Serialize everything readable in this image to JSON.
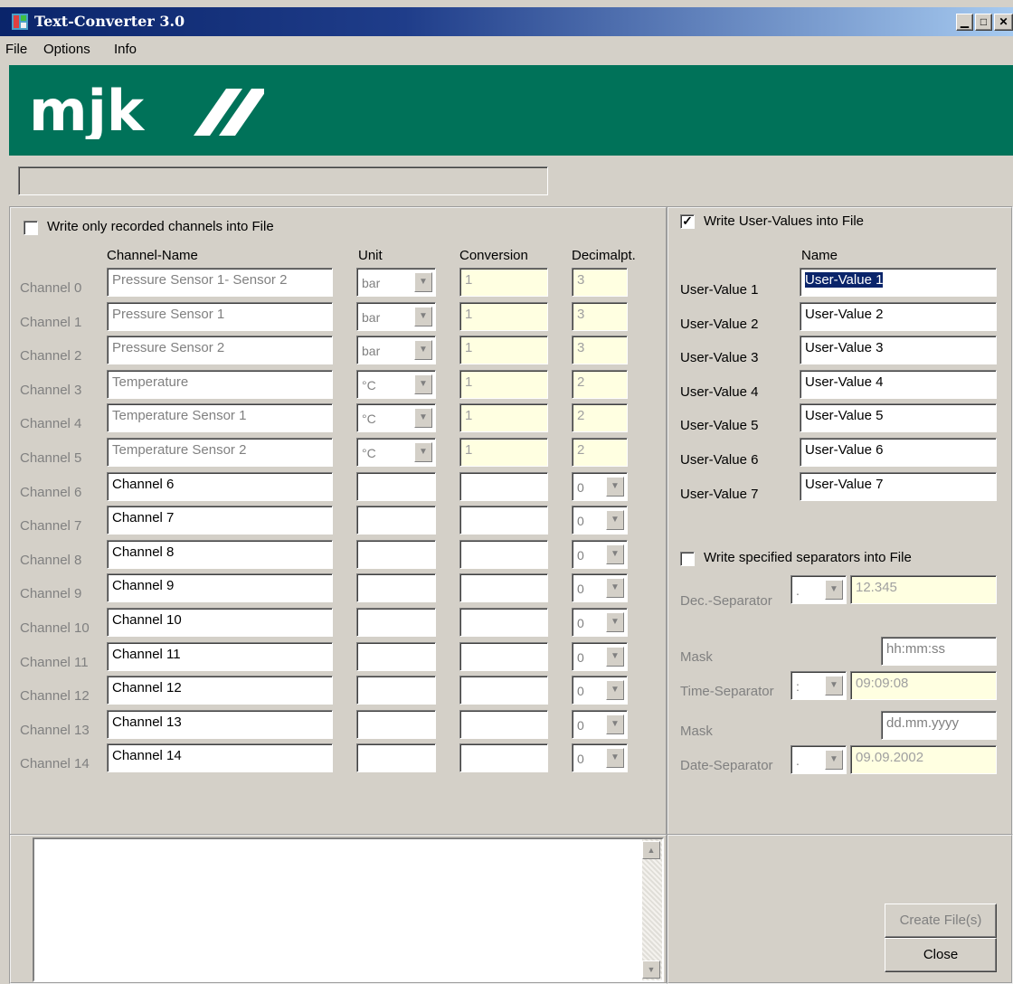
{
  "window": {
    "title": "Text-Converter 3.0"
  },
  "menu": {
    "file": "File",
    "options": "Options",
    "info": "Info"
  },
  "brand": {
    "logo_text": "mjk",
    "bg_color": "#007259"
  },
  "channels_panel": {
    "write_only_recorded_label": "Write only recorded channels into File",
    "write_only_recorded_checked": false,
    "headers": {
      "name": "Channel-Name",
      "unit": "Unit",
      "conversion": "Conversion",
      "decimalpt": "Decimalpt."
    },
    "rows": [
      {
        "label": "Channel 0",
        "name": "Pressure Sensor 1- Sensor 2",
        "unit": "bar",
        "conversion": "1",
        "decimal": "3",
        "recorded": true
      },
      {
        "label": "Channel 1",
        "name": "Pressure Sensor 1",
        "unit": "bar",
        "conversion": "1",
        "decimal": "3",
        "recorded": true
      },
      {
        "label": "Channel 2",
        "name": "Pressure Sensor 2",
        "unit": "bar",
        "conversion": "1",
        "decimal": "3",
        "recorded": true
      },
      {
        "label": "Channel 3",
        "name": "Temperature",
        "unit": "°C",
        "conversion": "1",
        "decimal": "2",
        "recorded": true
      },
      {
        "label": "Channel 4",
        "name": "Temperature Sensor 1",
        "unit": "°C",
        "conversion": "1",
        "decimal": "2",
        "recorded": true
      },
      {
        "label": "Channel 5",
        "name": "Temperature Sensor 2",
        "unit": "°C",
        "conversion": "1",
        "decimal": "2",
        "recorded": true
      },
      {
        "label": "Channel 6",
        "name": "Channel 6",
        "unit": "",
        "conversion": "",
        "decimal": "0",
        "recorded": false
      },
      {
        "label": "Channel 7",
        "name": "Channel 7",
        "unit": "",
        "conversion": "",
        "decimal": "0",
        "recorded": false
      },
      {
        "label": "Channel 8",
        "name": "Channel 8",
        "unit": "",
        "conversion": "",
        "decimal": "0",
        "recorded": false
      },
      {
        "label": "Channel 9",
        "name": "Channel 9",
        "unit": "",
        "conversion": "",
        "decimal": "0",
        "recorded": false
      },
      {
        "label": "Channel 10",
        "name": "Channel 10",
        "unit": "",
        "conversion": "",
        "decimal": "0",
        "recorded": false
      },
      {
        "label": "Channel 11",
        "name": "Channel 11",
        "unit": "",
        "conversion": "",
        "decimal": "0",
        "recorded": false
      },
      {
        "label": "Channel 12",
        "name": "Channel 12",
        "unit": "",
        "conversion": "",
        "decimal": "0",
        "recorded": false
      },
      {
        "label": "Channel 13",
        "name": "Channel 13",
        "unit": "",
        "conversion": "",
        "decimal": "0",
        "recorded": false
      },
      {
        "label": "Channel 14",
        "name": "Channel 14",
        "unit": "",
        "conversion": "",
        "decimal": "0",
        "recorded": false
      }
    ]
  },
  "user_values_panel": {
    "write_user_values_label": "Write User-Values into File",
    "write_user_values_checked": true,
    "name_header": "Name",
    "items": [
      {
        "label": "User-Value 1",
        "value": "User-Value 1"
      },
      {
        "label": "User-Value 2",
        "value": "User-Value 2"
      },
      {
        "label": "User-Value 3",
        "value": "User-Value 3"
      },
      {
        "label": "User-Value 4",
        "value": "User-Value 4"
      },
      {
        "label": "User-Value 5",
        "value": "User-Value 5"
      },
      {
        "label": "User-Value 6",
        "value": "User-Value 6"
      },
      {
        "label": "User-Value 7",
        "value": "User-Value 7"
      }
    ]
  },
  "separators_panel": {
    "write_separators_label": "Write specified separators into File",
    "write_separators_checked": false,
    "dec_label": "Dec.-Separator",
    "dec_value": ".",
    "dec_preview": "12.345",
    "time_mask_label": "Mask",
    "time_mask": "hh:mm:ss",
    "time_label": "Time-Separator",
    "time_value": ":",
    "time_preview": "09:09:08",
    "date_mask_label": "Mask",
    "date_mask": "dd.mm.yyyy",
    "date_label": "Date-Separator",
    "date_value": ".",
    "date_preview": "09.09.2002"
  },
  "buttons": {
    "create_files": "Create File(s)",
    "close": "Close"
  }
}
